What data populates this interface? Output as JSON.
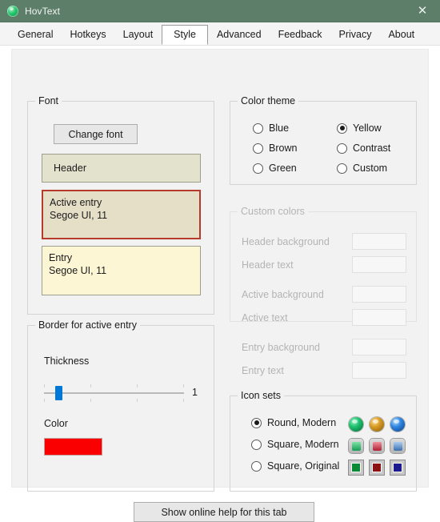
{
  "window": {
    "title": "HovText",
    "icon": "app-circle-icon",
    "close_label": "✕",
    "titlebar_color": "#5d7e69"
  },
  "tabs": [
    {
      "label": "General",
      "selected": false
    },
    {
      "label": "Hotkeys",
      "selected": false
    },
    {
      "label": "Layout",
      "selected": false
    },
    {
      "label": "Style",
      "selected": true
    },
    {
      "label": "Advanced",
      "selected": false
    },
    {
      "label": "Feedback",
      "selected": false
    },
    {
      "label": "Privacy",
      "selected": false
    },
    {
      "label": "About",
      "selected": false
    }
  ],
  "font_group": {
    "legend": "Font",
    "change_font_button": "Change font",
    "previews": {
      "header": {
        "title": "Header",
        "detail": "",
        "bg": "#e2e2cd",
        "border": "#9e9e8e"
      },
      "active": {
        "title": "Active entry",
        "detail": "Segoe UI, 11",
        "bg": "#e6dfc8",
        "border": "#b83a2d"
      },
      "entry": {
        "title": "Entry",
        "detail": "Segoe UI, 11",
        "bg": "#fcf6d4",
        "border": "#9e9e8e"
      }
    }
  },
  "border_group": {
    "legend": "Border for active entry",
    "thickness_label": "Thickness",
    "thickness_value": "1",
    "color_label": "Color",
    "color_value": "#fb0000"
  },
  "theme_group": {
    "legend": "Color theme",
    "options": [
      {
        "label": "Blue",
        "selected": false
      },
      {
        "label": "Brown",
        "selected": false
      },
      {
        "label": "Green",
        "selected": false
      },
      {
        "label": "Yellow",
        "selected": true
      },
      {
        "label": "Contrast",
        "selected": false
      },
      {
        "label": "Custom",
        "selected": false
      }
    ]
  },
  "custom_colors_group": {
    "legend": "Custom colors",
    "enabled": false,
    "fields": [
      {
        "label": "Header background",
        "value": ""
      },
      {
        "label": "Header text",
        "value": ""
      },
      {
        "label": "Active background",
        "value": ""
      },
      {
        "label": "Active text",
        "value": ""
      },
      {
        "label": "Entry background",
        "value": ""
      },
      {
        "label": "Entry text",
        "value": ""
      }
    ]
  },
  "icon_sets_group": {
    "legend": "Icon sets",
    "options": [
      {
        "label": "Round, Modern",
        "selected": true,
        "style": "round",
        "colors": [
          "green",
          "orange",
          "blue"
        ]
      },
      {
        "label": "Square, Modern",
        "selected": false,
        "style": "sqmodern",
        "colors": [
          "green",
          "red",
          "blue"
        ]
      },
      {
        "label": "Square, Original",
        "selected": false,
        "style": "sqorig",
        "colors": [
          "green",
          "red",
          "blue"
        ]
      }
    ]
  },
  "footer": {
    "help_button": "Show online help for this tab"
  }
}
